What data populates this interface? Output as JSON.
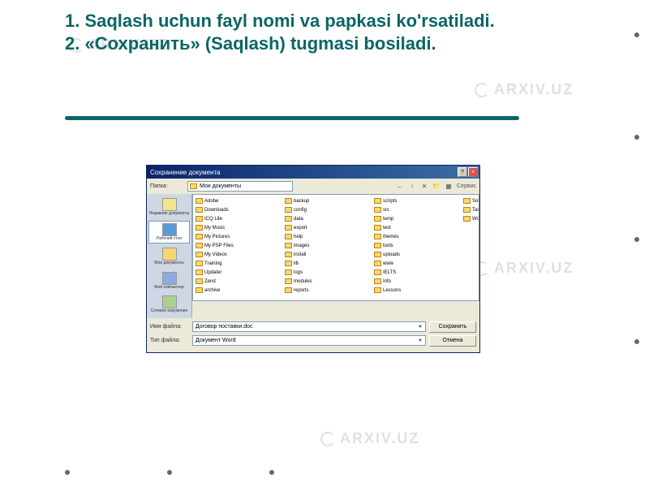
{
  "watermark": "ARXIV.UZ",
  "title_line1": "1. Saqlash uchun fayl nomi va papkasi ko'rsatiladi.",
  "title_line2": "2. «Сохранить» (Saqlash) tugmasi bosiladi.",
  "dialog": {
    "title": "Сохранение документа",
    "lookin_label": "Папка:",
    "lookin_value": "Мои документы",
    "places": {
      "recent": "Недавние документы",
      "desktop": "Рабочий стол",
      "mydocs": "Мои документы",
      "computer": "Мой компьютер",
      "network": "Сетевое окружение"
    },
    "folders": [
      "Adobe",
      "Downloads",
      "ICQ Lite",
      "My Music",
      "My Pictures",
      "My PSP Files",
      "My Videos",
      "Training",
      "Updater",
      "Zend",
      "archive",
      "backup",
      "config",
      "data",
      "export",
      "help",
      "images",
      "install",
      "lib",
      "logs",
      "modules",
      "reports",
      "scripts",
      "src",
      "temp",
      "test",
      "themes",
      "tools",
      "uploads",
      "www",
      "IELTS",
      "Info",
      "Lessons",
      "Soft",
      "Tasks",
      "Works"
    ],
    "filename_label": "Имя файла:",
    "filename_value": "Договор поставки.doc",
    "filetype_label": "Тип файла:",
    "filetype_value": "Документ Word",
    "tools_label": "Сервис",
    "save_btn": "Сохранить",
    "cancel_btn": "Отмена"
  }
}
